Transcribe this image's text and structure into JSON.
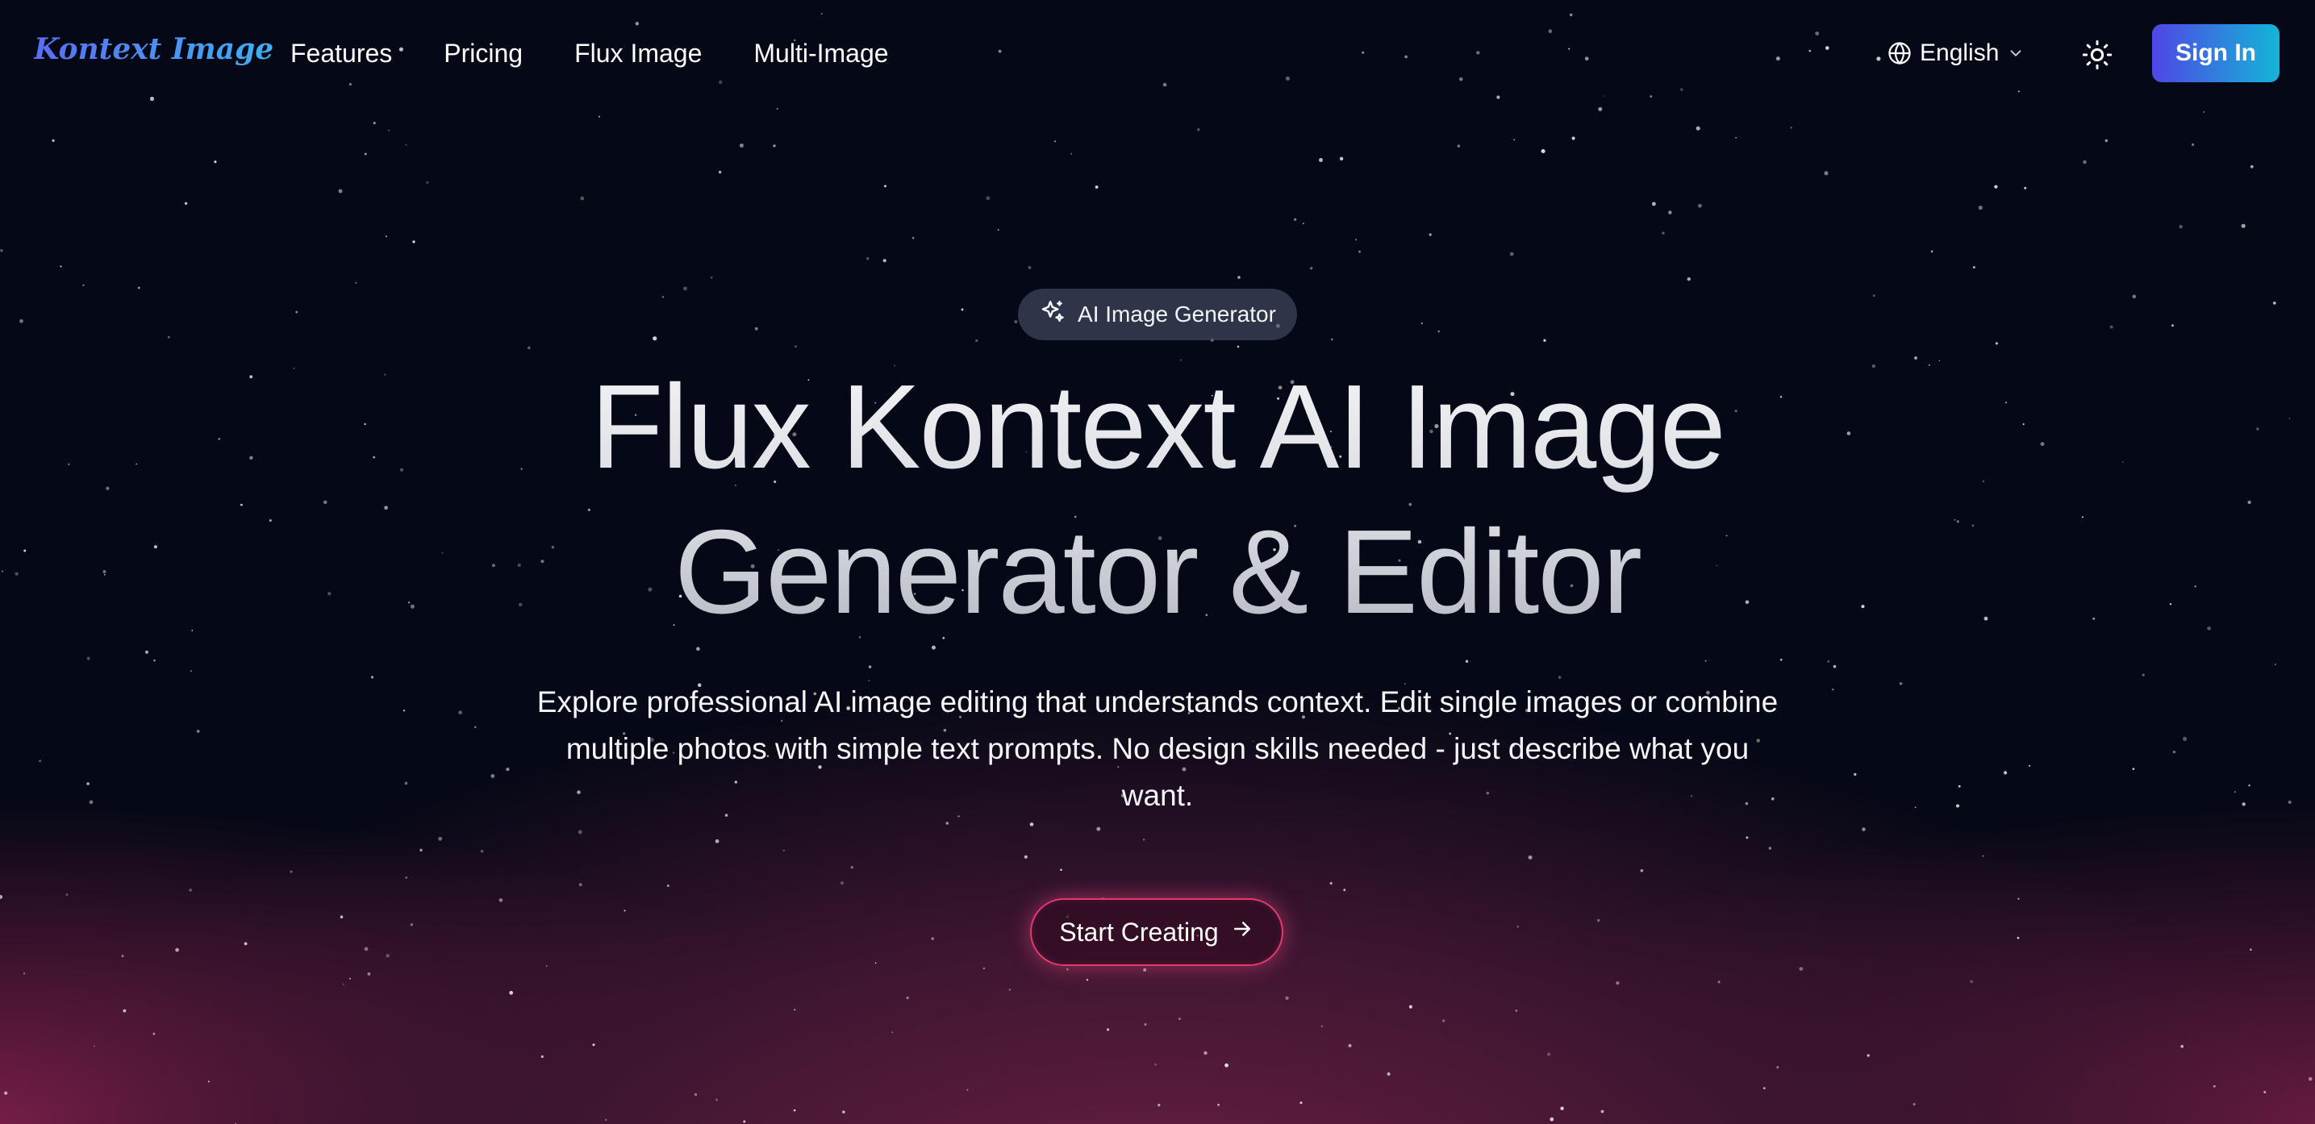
{
  "header": {
    "logo_text": "Kontext Image",
    "nav": [
      {
        "label": "Features"
      },
      {
        "label": "Pricing"
      },
      {
        "label": "Flux Image"
      },
      {
        "label": "Multi-Image"
      }
    ],
    "language": {
      "label": "English",
      "icon": "globe-icon"
    },
    "theme_toggle_icon": "sun-icon",
    "sign_in_label": "Sign In"
  },
  "hero": {
    "badge": {
      "label": "AI Image Generator",
      "icon": "sparkles-icon"
    },
    "title_line1": "Flux Kontext AI Image",
    "title_line2": "Generator & Editor",
    "description_line1": "Explore professional AI image editing that understands context. Edit single images or combine",
    "description_line2": "multiple photos with simple text prompts. No design skills needed - just describe what you",
    "description_line3": "want.",
    "cta_label": "Start Creating",
    "cta_icon": "arrow-right-icon"
  },
  "colors": {
    "background": "#050816",
    "glow": "#a8285a",
    "sign_in_gradient_start": "#4f46e5",
    "sign_in_gradient_end": "#13b5d8",
    "cta_border": "#e03a6e"
  }
}
